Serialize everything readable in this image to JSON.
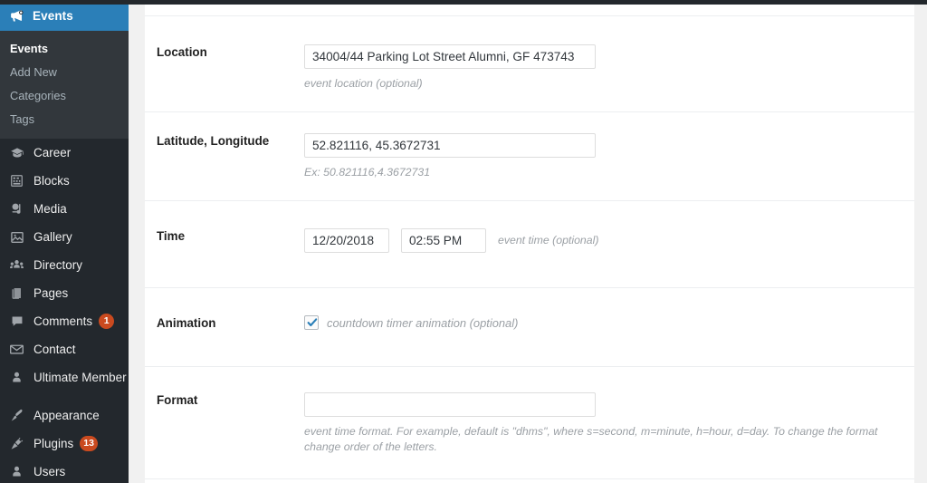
{
  "sidebar": {
    "active_menu": {
      "label": "Events",
      "icon": "megaphone-icon"
    },
    "submenu": [
      {
        "label": "Events",
        "current": true
      },
      {
        "label": "Add New",
        "current": false
      },
      {
        "label": "Categories",
        "current": false
      },
      {
        "label": "Tags",
        "current": false
      }
    ],
    "groups": [
      {
        "items": [
          {
            "label": "Career",
            "icon": "graduation-cap-icon",
            "badge": ""
          },
          {
            "label": "Blocks",
            "icon": "blocks-icon",
            "badge": ""
          },
          {
            "label": "Media",
            "icon": "media-icon",
            "badge": ""
          },
          {
            "label": "Gallery",
            "icon": "gallery-image-icon",
            "badge": ""
          },
          {
            "label": "Directory",
            "icon": "directory-users-icon",
            "badge": ""
          },
          {
            "label": "Pages",
            "icon": "pages-icon",
            "badge": ""
          },
          {
            "label": "Comments",
            "icon": "comment-bubble-icon",
            "badge": "1"
          },
          {
            "label": "Contact",
            "icon": "envelope-icon",
            "badge": ""
          },
          {
            "label": "Ultimate Member",
            "icon": "user-icon",
            "badge": ""
          }
        ]
      },
      {
        "items": [
          {
            "label": "Appearance",
            "icon": "paintbrush-icon",
            "badge": ""
          },
          {
            "label": "Plugins",
            "icon": "plug-icon",
            "badge": "13"
          },
          {
            "label": "Users",
            "icon": "user-icon",
            "badge": ""
          }
        ]
      }
    ]
  },
  "form": {
    "location": {
      "label": "Location",
      "value": "34004/44 Parking Lot Street Alumni, GF 473743",
      "placeholder": "",
      "hint": "event location (optional)"
    },
    "latlng": {
      "label": "Latitude, Longitude",
      "value": "52.821116, 45.3672731",
      "placeholder": "",
      "hint": "Ex: 50.821116,4.3672731"
    },
    "time": {
      "label": "Time",
      "date_value": "12/20/2018",
      "date_placeholder": "",
      "time_value": "02:55 PM",
      "time_placeholder": "",
      "hint": "event time (optional)"
    },
    "animation": {
      "label": "Animation",
      "checked": true,
      "checkbox_label": "countdown timer animation (optional)"
    },
    "format": {
      "label": "Format",
      "value": "",
      "placeholder": "",
      "hint": "event time format. For example, default is \"dhms\", where s=second, m=minute, h=hour, d=day. To change the format change order of the letters."
    }
  },
  "colors": {
    "sidebar_bg": "#23282d",
    "submenu_bg": "#32373c",
    "accent_blue": "#2b7fb8",
    "badge_red": "#ca4a1f",
    "content_bg": "#ffffff",
    "page_bg": "#f1f1f1"
  }
}
